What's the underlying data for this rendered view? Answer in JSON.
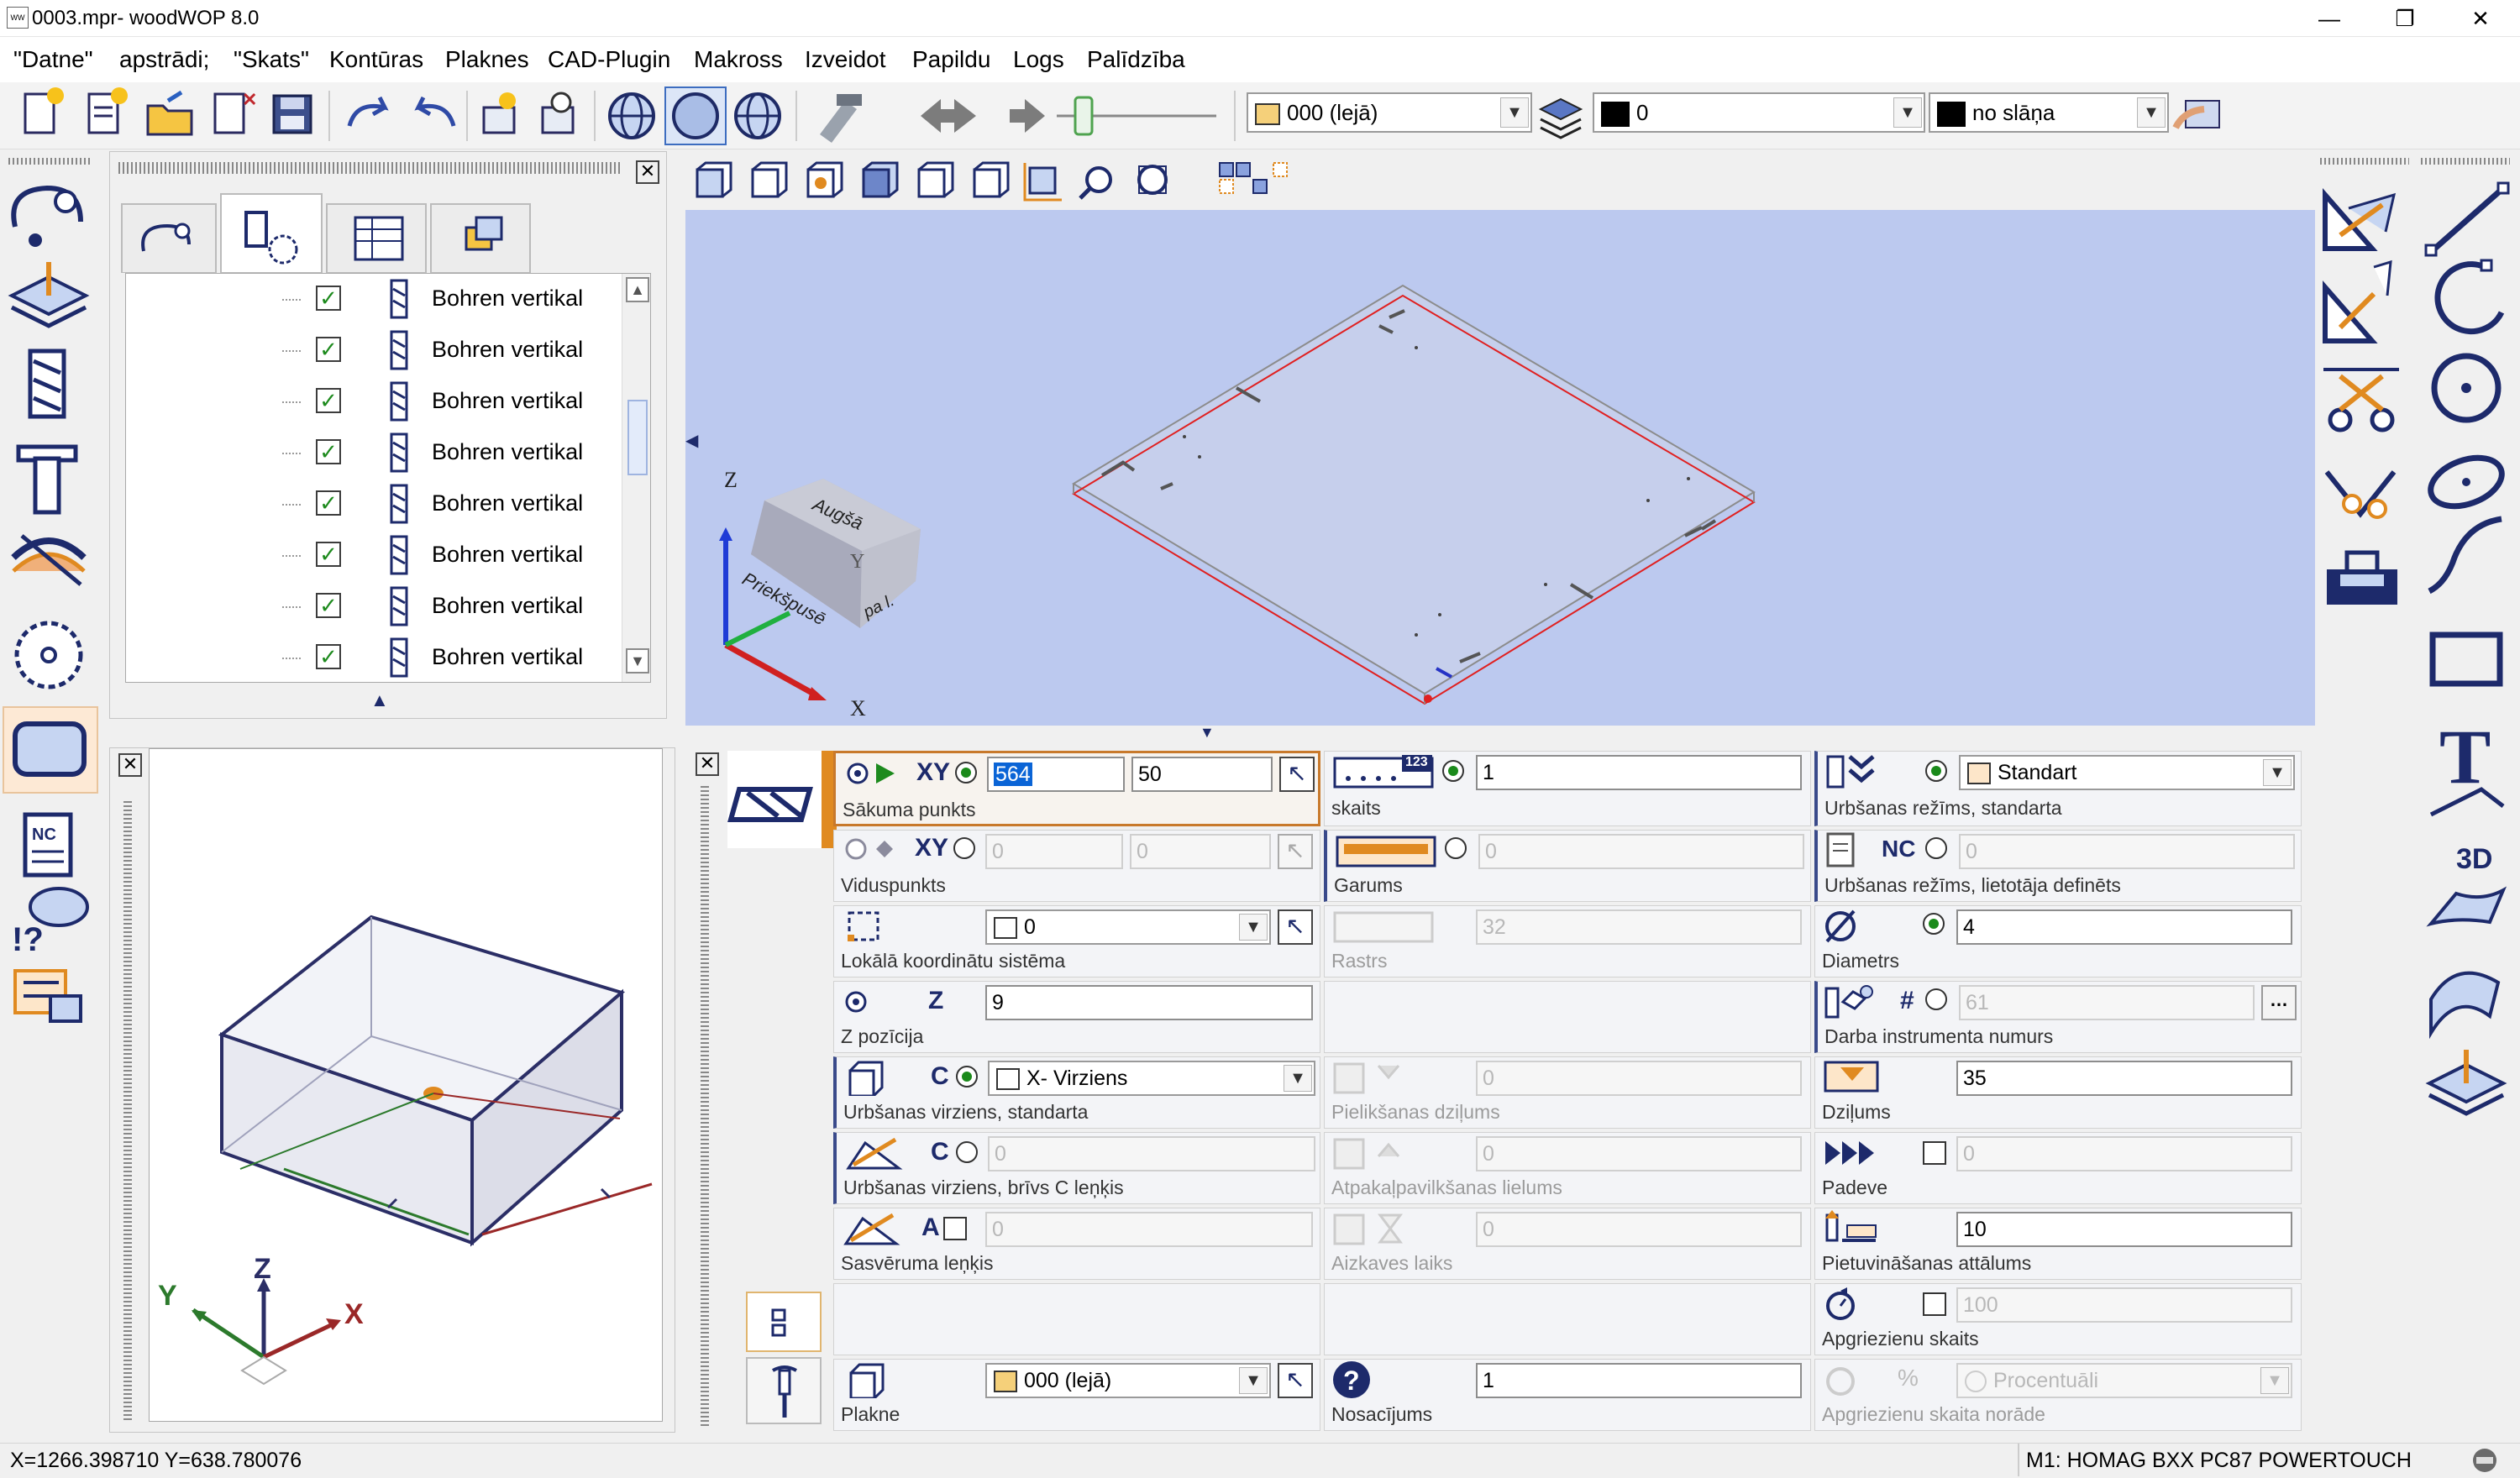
{
  "window": {
    "title": "0003.mpr- woodWOP 8.0",
    "app_icon_text": "WW"
  },
  "menu": [
    "\"Datne\"",
    "apstrādi;",
    "\"Skats\"",
    "Kontūras",
    "Plaknes",
    "CAD-Plugin",
    "Makross",
    "Izveidot",
    "Papildu",
    "Logs",
    "Palīdzība"
  ],
  "toolbar": {
    "plane_combo": "000  (lejā)",
    "layer_combo": "0",
    "color_combo": "no slāņa"
  },
  "tree": {
    "items": [
      "Bohren vertikal",
      "Bohren vertikal",
      "Bohren vertikal",
      "Bohren vertikal",
      "Bohren vertikal",
      "Bohren vertikal",
      "Bohren vertikal",
      "Bohren vertikal"
    ]
  },
  "viewcube": {
    "top": "Augšā",
    "front": "Priekšpusē",
    "side": "pa l.",
    "axis_z": "Z",
    "axis_x": "X",
    "axis_y": "Y"
  },
  "preview_axes": {
    "z": "Z",
    "x": "X",
    "y": "Y"
  },
  "form": {
    "start_point": {
      "label": "Sākuma punkts",
      "mode": "XY",
      "x": "564",
      "y": "50"
    },
    "mid_point": {
      "label": "Viduspunkts",
      "mode": "XY",
      "x": "0",
      "y": "0"
    },
    "local_cs": {
      "label": "Lokālā koordinātu sistēma",
      "value": "0"
    },
    "z_pos": {
      "label": "Z pozīcija",
      "mode": "Z",
      "value": "9"
    },
    "drill_dir": {
      "label": "Urbšanas virziens, standarta",
      "mode": "C",
      "value": "X- Virziens"
    },
    "drill_dir_free": {
      "label": "Urbšanas virziens, brīvs C leņķis",
      "mode": "C",
      "value": "0"
    },
    "tilt": {
      "label": "Sasvēruma leņķis",
      "mode": "A",
      "value": "0"
    },
    "plane": {
      "label": "Plakne",
      "value": "000 (lejā)"
    },
    "count": {
      "label": "skaits",
      "value": "1",
      "badge": "123"
    },
    "length": {
      "label": "Garums",
      "value": "0"
    },
    "raster": {
      "label": "Rastrs",
      "value": "32"
    },
    "add_depth": {
      "label": "Pielikšanas dziļums",
      "value": "0"
    },
    "retract": {
      "label": "Atpakaļpavilkšanas lielums",
      "value": "0"
    },
    "delay": {
      "label": "Aizkaves laiks",
      "value": "0"
    },
    "condition": {
      "label": "Nosacījums",
      "value": "1"
    },
    "drill_mode_std": {
      "label": "Urbšanas režīms, standarta",
      "value": "Standart"
    },
    "drill_mode_user": {
      "label": "Urbšanas režīms, lietotāja definēts",
      "mode": "NC",
      "value": "0"
    },
    "diameter": {
      "label": "Diametrs",
      "value": "4"
    },
    "tool_number": {
      "label": "Darba instrumenta numurs",
      "mode": "#",
      "value": "61"
    },
    "depth": {
      "label": "Dziļums",
      "value": "35"
    },
    "feed": {
      "label": "Padeve",
      "value": "0"
    },
    "approach": {
      "label": "Pietuvināšanas attālums",
      "value": "10"
    },
    "rpm": {
      "label": "Apgriezienu skaits",
      "value": "100"
    },
    "rpm_spec": {
      "label": "Apgriezienu skaita norāde",
      "mode": "%",
      "value": "Procentuāli"
    }
  },
  "status": {
    "coords": "X=1266.398710 Y=638.780076",
    "machine": "M1: HOMAG BXX PC87 POWERTOUCH"
  },
  "colors": {
    "viewport_bg": "#bcc9ef",
    "accent_orange": "#d9781f",
    "navy": "#1f2a6b"
  }
}
